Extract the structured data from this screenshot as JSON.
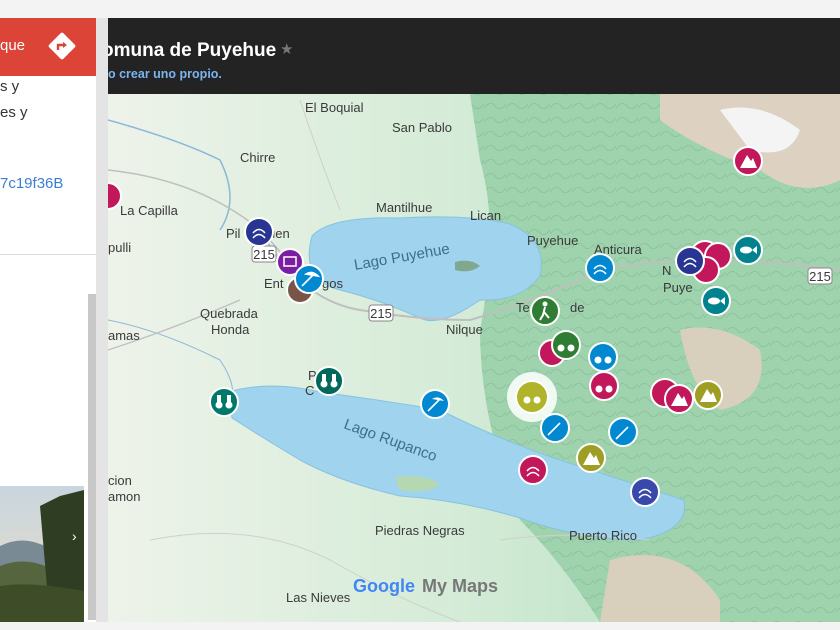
{
  "left_panel": {
    "directions_label": "que",
    "description_lines": [
      "s y",
      "es y"
    ],
    "hash_text": "7c19f36B"
  },
  "map": {
    "title": "omuna de Puyehue",
    "subtitle": "o crear uno propio.",
    "lakes": [
      "Lago Puyehue",
      "Lago Rupanco"
    ],
    "places": [
      "El Boquial",
      "San Pablo",
      "Chirre",
      "La Capilla",
      "Mantilhue",
      "Lican",
      "Puyehue",
      "Anticura",
      "Pil",
      "uen",
      "pulli",
      "Ent",
      "gos",
      "Quebrada",
      "Honda",
      "Nilque",
      "Te",
      "de",
      "amas",
      "P",
      "C",
      "Puerto Rico",
      "Piedras Negras",
      "Las Nieves",
      "amon",
      "cion",
      "N",
      "Puye"
    ],
    "routes": [
      "215",
      "215",
      "215"
    ],
    "logo_google": "Google",
    "logo_mymaps": "My Maps"
  }
}
